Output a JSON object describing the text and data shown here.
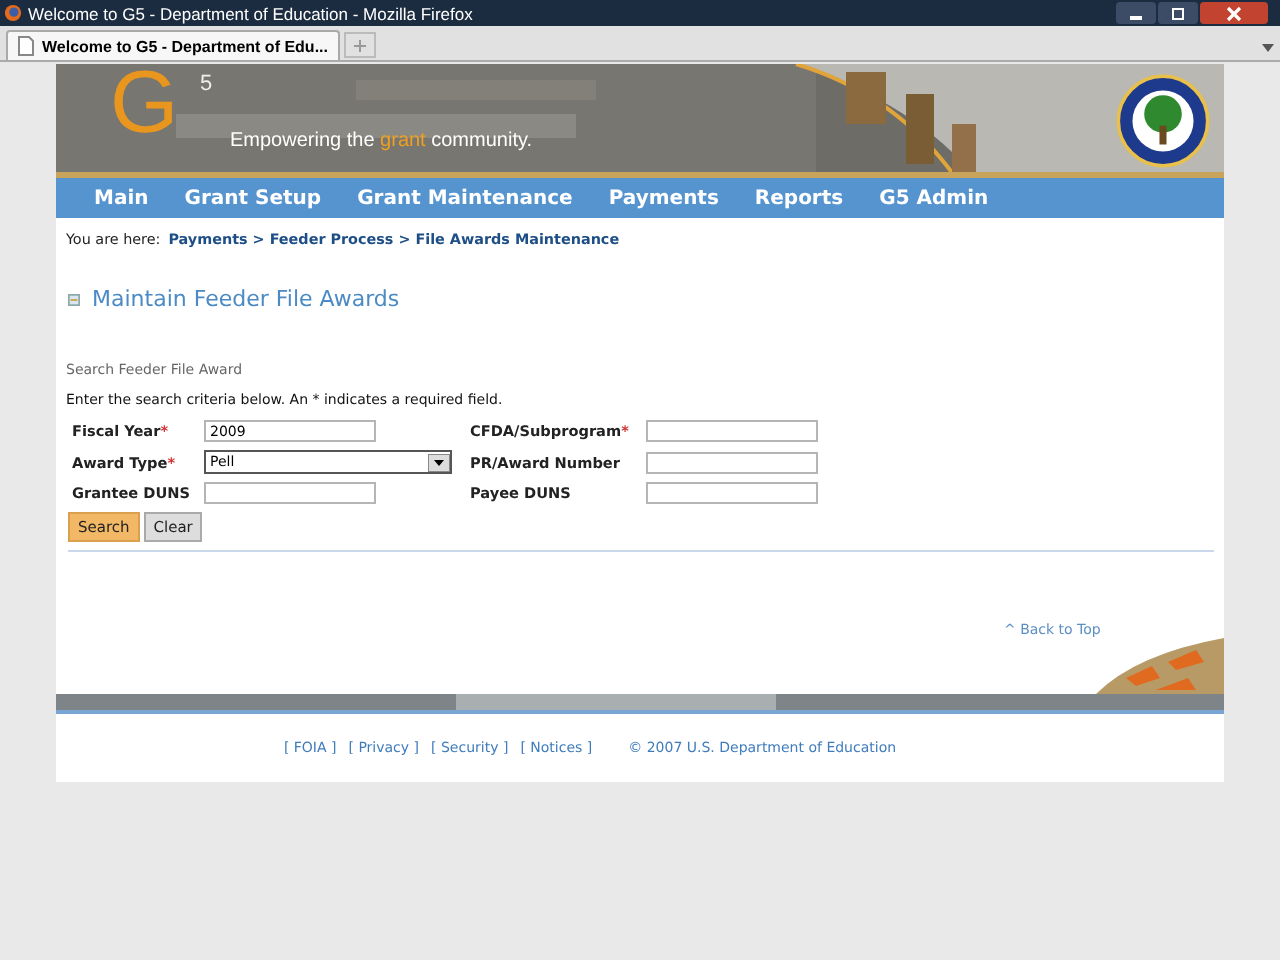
{
  "window": {
    "title": "Welcome to G5 - Department of Education - Mozilla Firefox"
  },
  "tabs": [
    {
      "label": "Welcome to G5 - Department of Edu...",
      "selected": true
    }
  ],
  "banner": {
    "logo_letter": "G",
    "logo_superscript": "5",
    "tagline_before": "Empowering the",
    "tagline_highlight": "grant",
    "tagline_after": "community."
  },
  "nav": [
    "Main",
    "Grant Setup",
    "Grant Maintenance",
    "Payments",
    "Reports",
    "G5 Admin"
  ],
  "breadcrumb": {
    "label": "You are here:",
    "path": "Payments > Feeder Process > File Awards Maintenance"
  },
  "heading": "Maintain Feeder File Awards",
  "section_title": "Search Feeder File Award",
  "instructions": "Enter the search criteria below. An * indicates a required field.",
  "fields": [
    {
      "label": "Fiscal Year",
      "required": true,
      "kind": "text",
      "value": "2009"
    },
    {
      "label": "CFDA/Subprogram",
      "required": true,
      "kind": "text"
    },
    {
      "label": "Award Type",
      "required": true,
      "kind": "select",
      "value": "Pell"
    },
    {
      "label": "PR/Award Number",
      "required": false,
      "kind": "text"
    },
    {
      "label": "Grantee DUNS",
      "required": false,
      "kind": "text"
    },
    {
      "label": "Payee DUNS",
      "required": false,
      "kind": "text"
    }
  ],
  "required_mark": "*",
  "buttons": [
    {
      "label": "Search",
      "kind": "primary"
    },
    {
      "label": "Clear",
      "kind": "secondary"
    }
  ],
  "back_to_top": "^ Back to Top",
  "footer": {
    "links": [
      "[ FOIA ]",
      "[ Privacy ]",
      "[ Security ]",
      "[ Notices ]"
    ],
    "copyright": "© 2007 U.S. Department of Education"
  }
}
